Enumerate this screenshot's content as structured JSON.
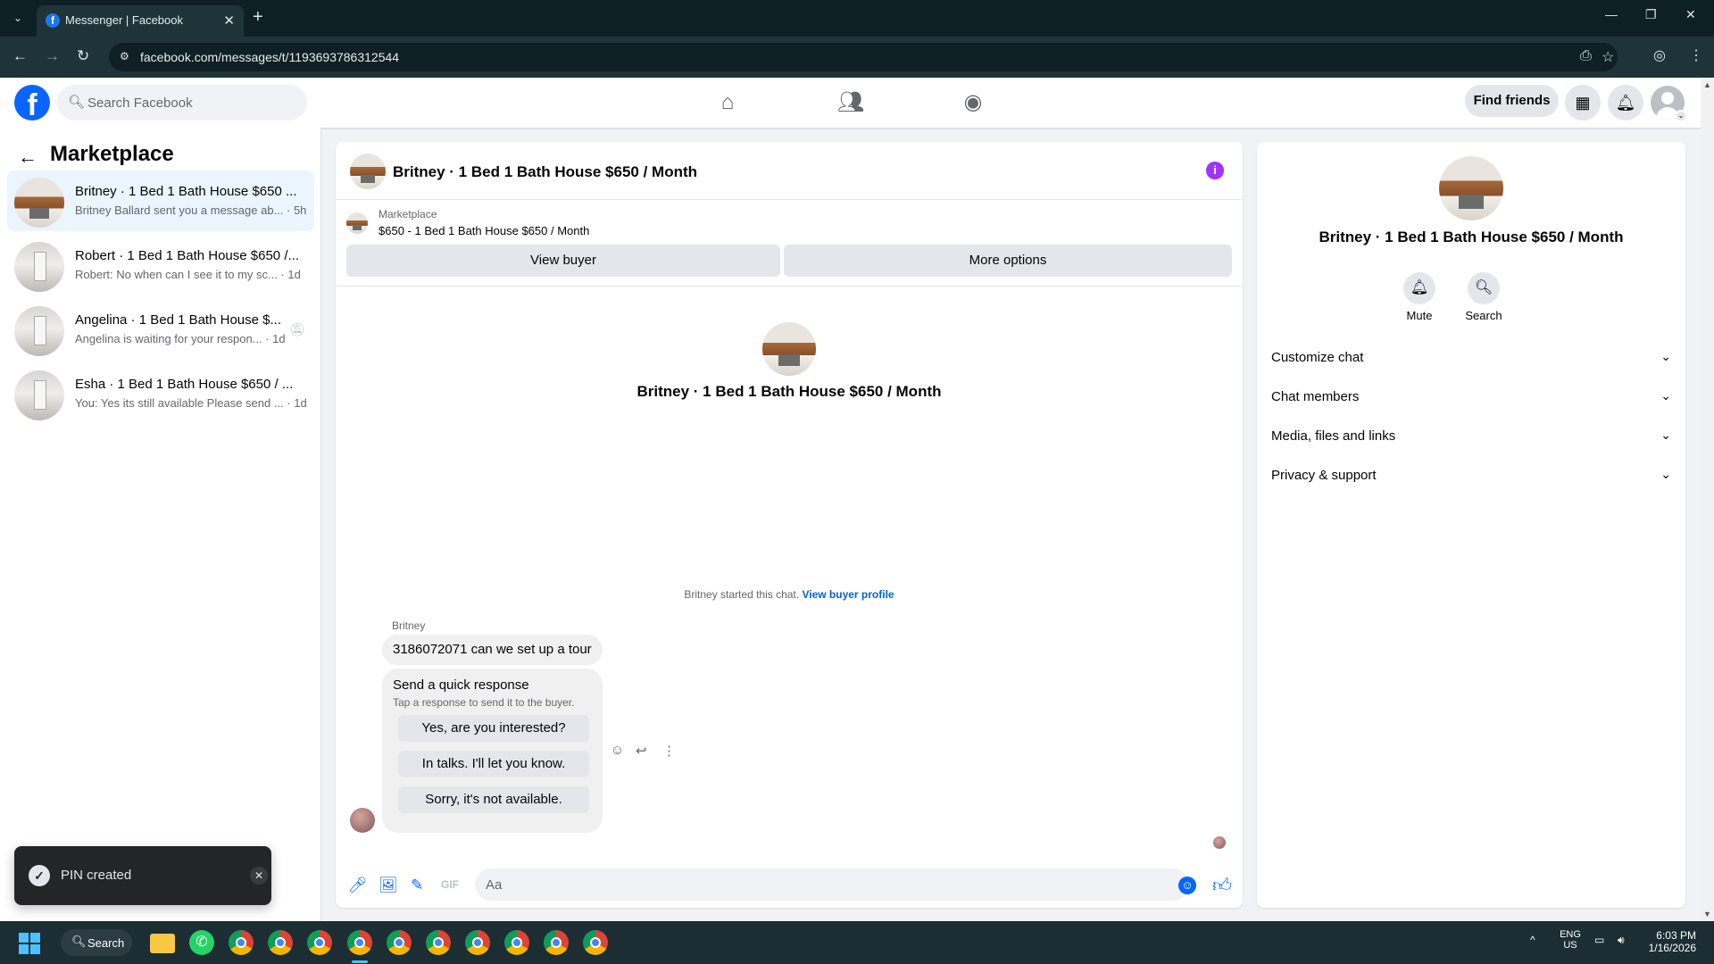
{
  "browser": {
    "tab_title": "Messenger | Facebook",
    "url": "facebook.com/messages/t/1193693786312544"
  },
  "header": {
    "search_placeholder": "Search Facebook",
    "find_friends": "Find friends"
  },
  "sidebar": {
    "title": "Marketplace",
    "conversations": [
      {
        "name": "Britney · 1 Bed 1 Bath House $650 ...",
        "snippet": "Britney Ballard sent you a message ab... · 5h",
        "active": true
      },
      {
        "name": "Robert · 1 Bed 1 Bath House $650 /...",
        "snippet": "Robert: No when can I see it to my sc... · 1d",
        "active": false
      },
      {
        "name": "Angelina · 1 Bed 1 Bath House $...",
        "snippet": "Angelina is waiting for your respon... · 1d",
        "active": false
      },
      {
        "name": "Esha · 1 Bed 1 Bath House $650 / ...",
        "snippet": "You: Yes its still available Please send ... · 1d",
        "active": false
      }
    ]
  },
  "chat": {
    "title": "Britney · 1 Bed 1 Bath House $650 / Month",
    "marketplace_label": "Marketplace",
    "listing": "$650 - 1 Bed 1 Bath House $650 / Month",
    "view_buyer": "View buyer",
    "more_options": "More options",
    "profile_name": "Britney · 1 Bed 1 Bath House $650 / Month",
    "started_text": "Britney started this chat.",
    "view_buyer_profile": "View buyer profile",
    "sender": "Britney",
    "message": "3186072071 can we set up a tour",
    "quick_title": "Send a quick response",
    "quick_sub": "Tap a response to send it to the buyer.",
    "quick_options": [
      "Yes, are you interested?",
      "In talks. I'll let you know.",
      "Sorry, it's not available."
    ],
    "composer_placeholder": "Aa"
  },
  "info_panel": {
    "name": "Britney · 1 Bed 1 Bath House $650 / Month",
    "mute": "Mute",
    "search": "Search",
    "sections": [
      "Customize chat",
      "Chat members",
      "Media, files and links",
      "Privacy & support"
    ]
  },
  "toast": {
    "text": "PIN created"
  },
  "taskbar": {
    "search": "Search",
    "lang_top": "ENG",
    "lang_bottom": "US",
    "time": "6:03 PM",
    "date": "1/16/2026"
  },
  "colors": {
    "brand": "#0866ff",
    "info": "#a033ff"
  }
}
